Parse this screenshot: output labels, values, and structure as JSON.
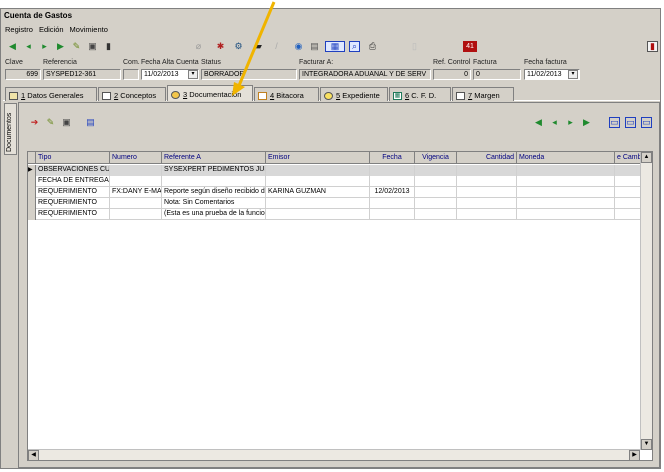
{
  "window": {
    "title": "Cuenta de Gastos"
  },
  "menu": [
    "Registro",
    "Edición",
    "Movimiento"
  ],
  "fields": {
    "clave": {
      "label": "Clave",
      "value": "699"
    },
    "referencia": {
      "label": "Referencia",
      "value": "SYSPED12-361"
    },
    "com": {
      "label": "Com.",
      "value": ""
    },
    "fecha_alta": {
      "label": "Fecha Alta Cuenta",
      "value": "11/02/2013"
    },
    "status": {
      "label": "Status",
      "value": "BORRADOR"
    },
    "facturar": {
      "label": "Facturar A:",
      "value": "INTEGRADORA ADUANAL Y DE  SERV"
    },
    "ref_control": {
      "label": "Ref. Control",
      "value": "0"
    },
    "factura": {
      "label": "Factura",
      "value": "0"
    },
    "fecha_factura": {
      "label": "Fecha factura",
      "value": "11/02/2013"
    }
  },
  "tabs": [
    {
      "key": "1",
      "label": "Datos Generales"
    },
    {
      "key": "2",
      "label": "Conceptos"
    },
    {
      "key": "3",
      "label": "Documentacion"
    },
    {
      "key": "4",
      "label": "Bitacora"
    },
    {
      "key": "5",
      "label": "Expediente"
    },
    {
      "key": "6",
      "label": "C. F. D."
    },
    {
      "key": "7",
      "label": "Margen"
    }
  ],
  "side_tab": "Documentos",
  "grid": {
    "columns": [
      "Tipo",
      "Numero",
      "Referente A",
      "Emisor",
      "Fecha",
      "Vigencia",
      "Cantidad",
      "Moneda",
      "e Cambio"
    ],
    "rows": [
      [
        "OBSERVACIONES CU",
        "",
        "SYSEXPERT PEDIMENTOS JUL",
        "",
        "",
        "",
        "",
        "",
        ""
      ],
      [
        "FECHA DE ENTREGA",
        "",
        "",
        "",
        "",
        "",
        "",
        "",
        ""
      ],
      [
        "REQUERIMIENTO",
        "FX:DANY E-MAI",
        "Reporte según diseño recibido de",
        "KARINA GUZMAN",
        "12/02/2013",
        "",
        "",
        "",
        ""
      ],
      [
        "REQUERIMIENTO",
        "",
        "Nota: Sin Comentarios",
        "",
        "",
        "",
        "",
        "",
        ""
      ],
      [
        "REQUERIMIENTO",
        "",
        "(Esta es una prueba de la funcion",
        "",
        "",
        "",
        "",
        "",
        ""
      ]
    ]
  },
  "colors": {
    "chrome": "#d4d0c8",
    "header_text": "#000080",
    "annotation_arrow": "#f0b400"
  }
}
